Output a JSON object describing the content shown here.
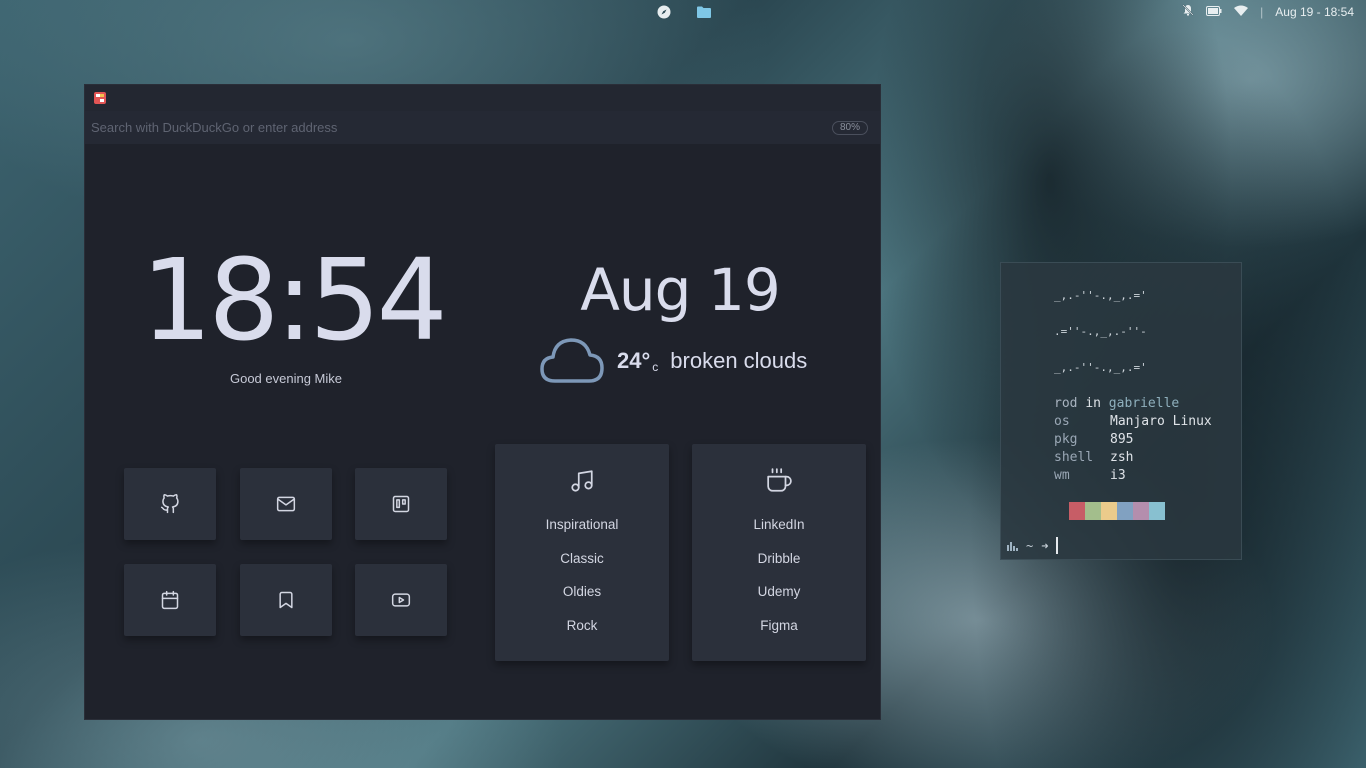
{
  "topbar": {
    "datetime": "Aug 19 - 18:54",
    "separator": "|",
    "center_icons": [
      "compass-icon",
      "folder-icon"
    ],
    "status_icons": [
      "notifications-off-icon",
      "battery-icon",
      "wifi-icon"
    ]
  },
  "browser": {
    "url_placeholder": "Search with DuckDuckGo or enter address",
    "zoom": "80%",
    "clock": "18:54",
    "greeting": "Good evening Mike",
    "date": "Aug 19",
    "weather": {
      "temperature": "24°",
      "unit": "c",
      "description": "broken clouds",
      "icon": "cloud-icon"
    },
    "shortcuts": [
      {
        "icon": "github-icon"
      },
      {
        "icon": "mail-icon"
      },
      {
        "icon": "trello-icon"
      },
      {
        "icon": "calendar-icon"
      },
      {
        "icon": "bookmark-icon"
      },
      {
        "icon": "youtube-icon"
      }
    ],
    "music_panel": {
      "icon": "music-icon",
      "links": [
        "Inspirational",
        "Classic",
        "Oldies",
        "Rock"
      ]
    },
    "work_panel": {
      "icon": "coffee-icon",
      "links": [
        "LinkedIn",
        "Dribble",
        "Udemy",
        "Figma"
      ]
    }
  },
  "terminal": {
    "ascii": [
      "_,.-''-.,_,.='",
      ".=''-.,_,.-''-",
      "_,.-''-.,_,.='"
    ],
    "user": "rod",
    "in_word": "in",
    "host": "gabrielle",
    "info": [
      {
        "key": "os",
        "value": "Manjaro Linux"
      },
      {
        "key": "pkg",
        "value": "895"
      },
      {
        "key": "shell",
        "value": "zsh"
      },
      {
        "key": "wm",
        "value": "i3"
      }
    ],
    "palette": [
      "#c75d66",
      "#a3be8c",
      "#ebcb8b",
      "#81a1c1",
      "#b48ead",
      "#88c0d0"
    ],
    "prompt": {
      "dir": "~",
      "arrow": "➜"
    }
  }
}
